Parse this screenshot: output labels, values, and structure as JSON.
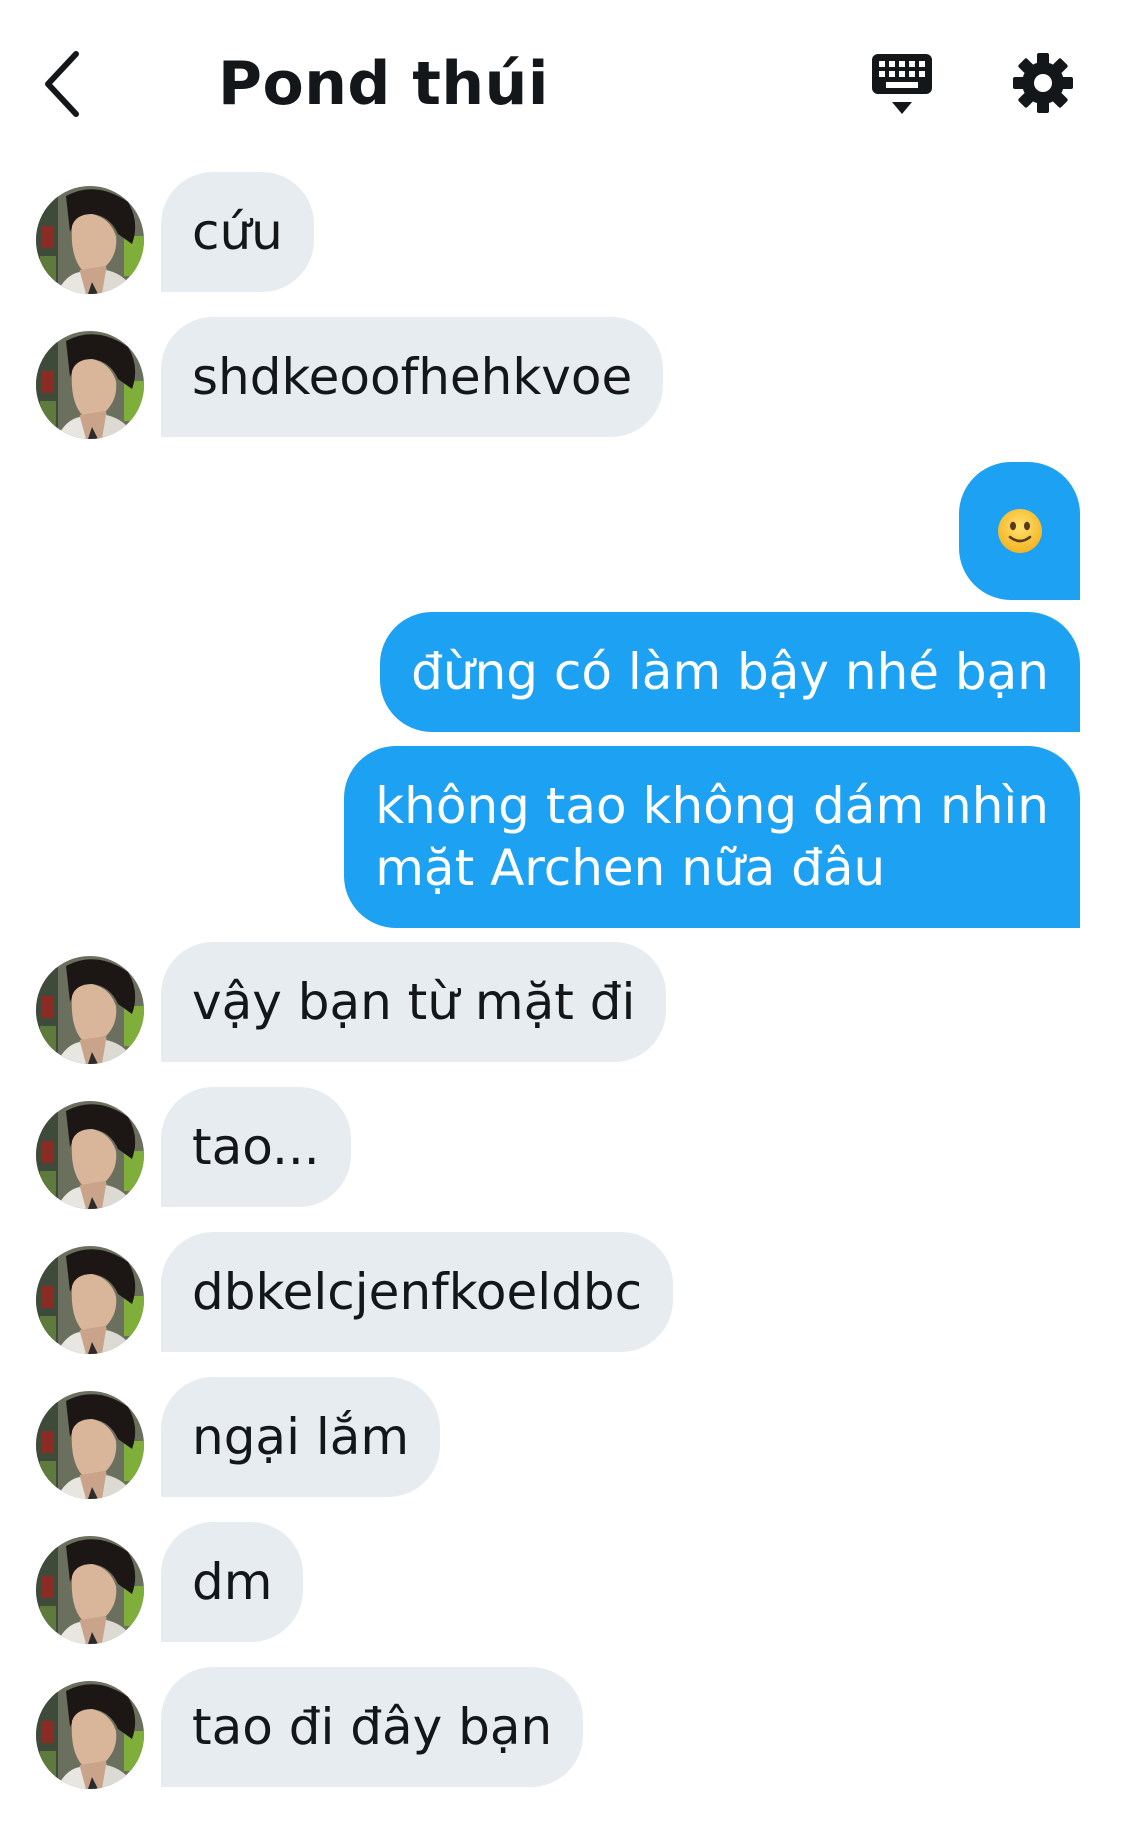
{
  "header": {
    "back_icon": "chevron-left-icon",
    "title": "Pond thúi",
    "keyboard_icon": "keyboard-icon",
    "settings_icon": "gear-icon"
  },
  "colors": {
    "incoming_bubble": "#e6ecf0",
    "outgoing_bubble": "#1da1f2",
    "text_dark": "#14171a"
  },
  "messages": [
    {
      "from": "contact",
      "text": "cứu"
    },
    {
      "from": "contact",
      "text": "shdkeoofhehkvoe"
    },
    {
      "from": "me",
      "emoji": "slightly-smiling-face"
    },
    {
      "from": "me",
      "text": "đừng có làm bậy nhé bạn"
    },
    {
      "from": "me",
      "lines": [
        "không tao không dám nhìn",
        "mặt Archen nữa đâu"
      ]
    },
    {
      "from": "contact",
      "text": "vậy bạn từ mặt đi"
    },
    {
      "from": "contact",
      "text": "tao..."
    },
    {
      "from": "contact",
      "text": "dbkelcjenfkoeldbc"
    },
    {
      "from": "contact",
      "text": "ngại lắm"
    },
    {
      "from": "contact",
      "text": "dm"
    },
    {
      "from": "contact",
      "text": "tao đi đây bạn"
    }
  ]
}
